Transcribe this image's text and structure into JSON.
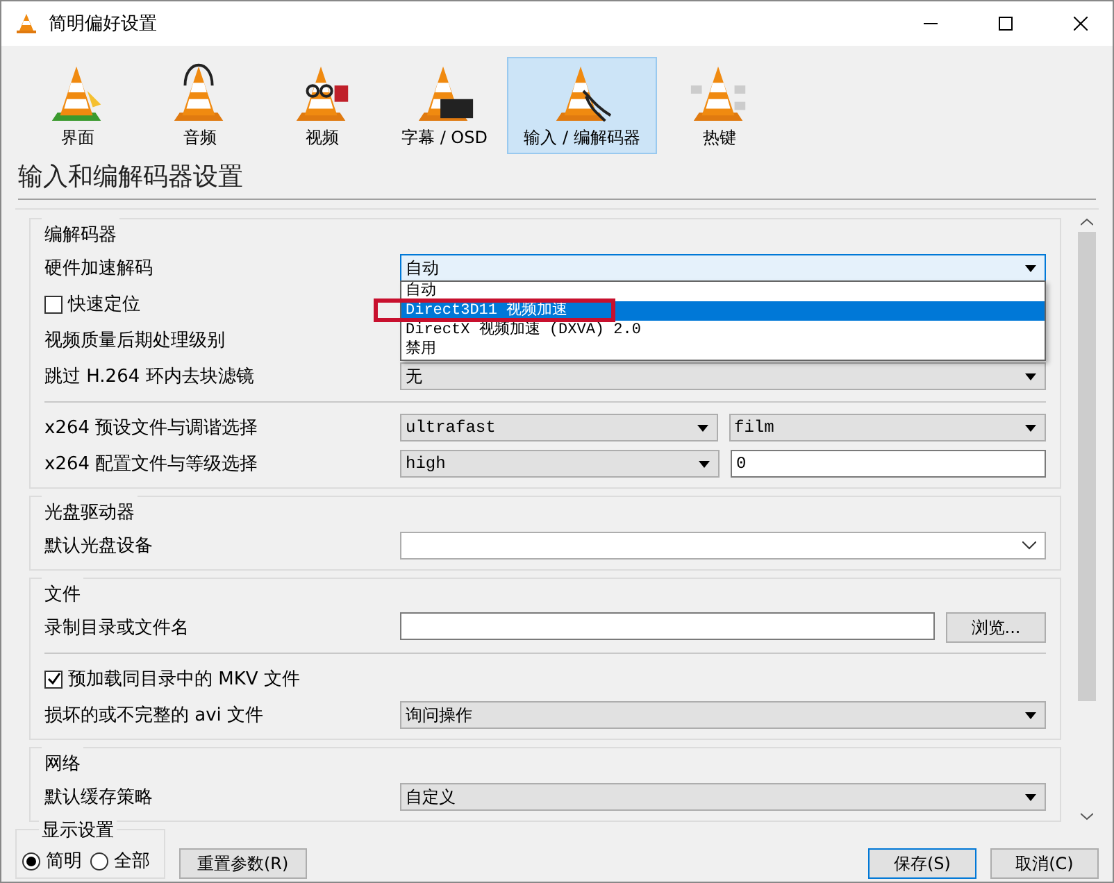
{
  "window": {
    "title": "简明偏好设置"
  },
  "categories": [
    {
      "label": "界面",
      "kind": "interface",
      "selected": false
    },
    {
      "label": "音频",
      "kind": "audio",
      "selected": false
    },
    {
      "label": "视频",
      "kind": "video",
      "selected": false
    },
    {
      "label": "字幕 / OSD",
      "kind": "subtitles",
      "selected": false
    },
    {
      "label": "输入 / 编解码器",
      "kind": "input",
      "selected": true
    },
    {
      "label": "热键",
      "kind": "hotkeys",
      "selected": false
    }
  ],
  "heading": "输入和编解码器设置",
  "sections": [
    {
      "title": "编解码器",
      "rows": [
        {
          "kind": "select",
          "label": "硬件加速解码",
          "value": "自动",
          "options": [
            {
              "label": "自动",
              "hovered": false,
              "framed": false
            },
            {
              "label": "Direct3D11 视频加速",
              "hovered": true,
              "framed": true
            },
            {
              "label": "DirectX 视频加速 (DXVA) 2.0",
              "hovered": false,
              "framed": false
            },
            {
              "label": "禁用",
              "hovered": false,
              "framed": false
            }
          ]
        },
        {
          "kind": "checkbox",
          "label": "快速定位",
          "checked": false
        },
        {
          "kind": "label",
          "label": "视频质量后期处理级别"
        },
        {
          "kind": "select",
          "label": "跳过 H.264 环内去块滤镜",
          "value": "无"
        },
        {
          "kind": "divider"
        },
        {
          "kind": "pair",
          "label": "x264 预设文件与调谐选择",
          "controls": [
            {
              "kind": "select",
              "value": "ultrafast"
            },
            {
              "kind": "select",
              "value": "film"
            }
          ]
        },
        {
          "kind": "pair",
          "label": "x264 配置文件与等级选择",
          "controls": [
            {
              "kind": "select",
              "value": "high"
            },
            {
              "kind": "input",
              "value": "0"
            }
          ]
        }
      ]
    },
    {
      "title": "光盘驱动器",
      "rows": [
        {
          "kind": "combo",
          "label": "默认光盘设备"
        }
      ]
    },
    {
      "title": "文件",
      "rows": [
        {
          "kind": "file",
          "label": "录制目录或文件名",
          "button": "浏览..."
        },
        {
          "kind": "divider"
        },
        {
          "kind": "checkbox",
          "label": "预加载同目录中的 MKV 文件",
          "checked": true
        },
        {
          "kind": "select",
          "label": "损坏的或不完整的 avi 文件",
          "value": "询问操作"
        }
      ]
    },
    {
      "title": "网络",
      "rows": [
        {
          "kind": "select",
          "label": "默认缓存策略",
          "value": "自定义"
        }
      ]
    }
  ],
  "display": {
    "title": "显示设置",
    "options": [
      {
        "label": "简明",
        "selected": true
      },
      {
        "label": "全部",
        "selected": false
      }
    ]
  },
  "reset_button": "重置参数(R)",
  "buttons": [
    {
      "label": "保存(S)",
      "default": true
    },
    {
      "label": "取消(C)",
      "default": false
    }
  ]
}
